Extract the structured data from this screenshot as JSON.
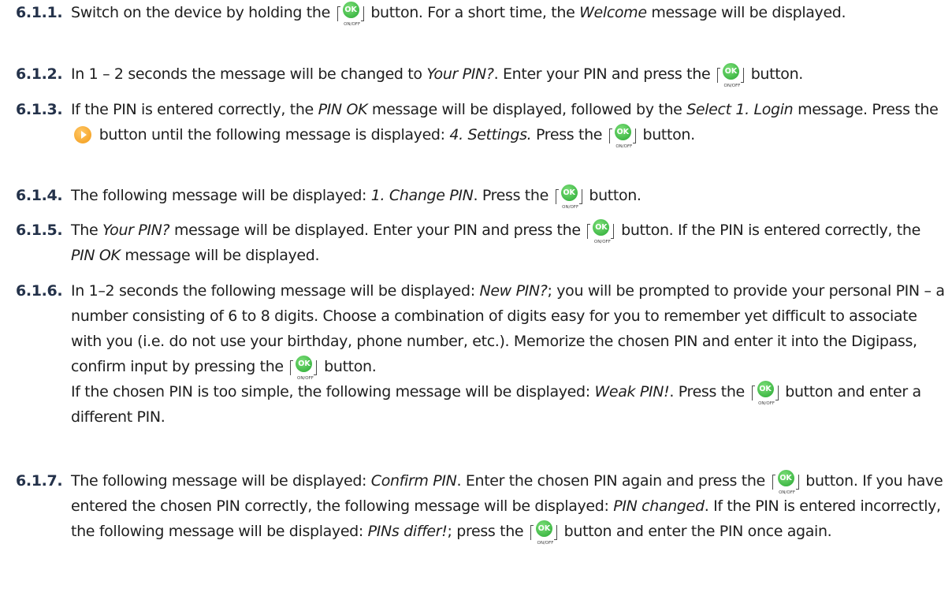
{
  "ok_button": {
    "label": "OK",
    "sublabel": "ON/OFF"
  },
  "steps": [
    {
      "num": "6.1.1.",
      "t1": "Switch on the device by holding the",
      "t2": "button. For a short time, the",
      "i1": "Welcome",
      "t3": "message will be displayed."
    },
    {
      "num": "6.1.2.",
      "t1": "In 1 – 2 seconds the message will be changed to",
      "i1": "Your PIN?",
      "t2": ". Enter your PIN and press the",
      "t3": "button."
    },
    {
      "num": "6.1.3.",
      "t1": "If the PIN is entered correctly, the",
      "i1": "PIN OK",
      "t2": "message will be displayed, followed by the",
      "i2": "Select 1. Login",
      "t3": "message. Press the",
      "t4": "button until the following message is displayed:",
      "i3": "4. Settings.",
      "t5": "Press the",
      "t6": "button."
    },
    {
      "num": "6.1.4.",
      "t1": "The following message will be displayed:",
      "i1": "1. Change PIN",
      "t2": ". Press the",
      "t3": "button."
    },
    {
      "num": "6.1.5.",
      "t1": "The",
      "i1": "Your PIN?",
      "t2": "message will be displayed. Enter your PIN and press the",
      "t3": "button. If the PIN is entered correctly, the",
      "i2": "PIN OK",
      "t4": "message will be displayed."
    },
    {
      "num": "6.1.6.",
      "t1": "In 1–2 seconds the following message will be displayed:",
      "i1": "New PIN?",
      "t2": "; you will be prompted to provide your personal PIN – a number consisting of 6 to 8 digits. Choose a combination of digits easy for you to remember yet difficult to associate with you (i.e. do not use your birthday, phone number, etc.). Memorize the chosen PIN and enter it into the Digipass, confirm input by pressing the",
      "t3": "button.",
      "t4": "If the chosen PIN is too simple, the following message will be displayed:",
      "i2": "Weak PIN!",
      "t5": ". Press the",
      "t6": "button and enter a different PIN."
    },
    {
      "num": "6.1.7.",
      "t1": "The following message will be displayed:",
      "i1": "Confirm PIN",
      "t2": ". Enter the chosen PIN again and press the",
      "t3": "button. If you have entered the chosen PIN correctly, the following message will be displayed:",
      "i2": "PIN changed",
      "t4": ". If the PIN is entered incorrectly, the following message will be displayed:",
      "i3": "PINs differ!",
      "t5": "; press the",
      "t6": "button and enter the PIN once again."
    }
  ]
}
